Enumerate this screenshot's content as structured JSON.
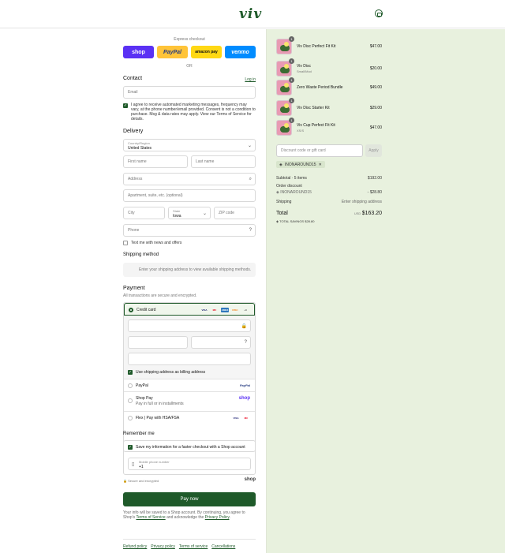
{
  "header": {
    "logo": "viv",
    "cart_icon": "bag-icon"
  },
  "express": {
    "label": "Express checkout",
    "wallets": [
      "shop",
      "PayPal",
      "amazon pay",
      "venmo"
    ],
    "or": "OR"
  },
  "contact": {
    "title": "Contact",
    "login": "Log in",
    "email_placeholder": "Email",
    "consent": "I agree to receive automated marketing messages, frequency may vary, at the phone number/email provided. Consent is not a condition to purchase. Msg & data rates may apply. View our Terms of Service for details."
  },
  "delivery": {
    "title": "Delivery",
    "country_label": "Country/Region",
    "country_value": "United States",
    "first_name": "First name",
    "last_name": "Last name",
    "address": "Address",
    "apartment": "Apartment, suite, etc. (optional)",
    "city": "City",
    "state_label": "State",
    "state_value": "Iowa",
    "zip": "ZIP code",
    "phone": "Phone",
    "text_me": "Text me with news and offers"
  },
  "shipping": {
    "title": "Shipping method",
    "note": "Enter your shipping address to view available shipping methods."
  },
  "payment": {
    "title": "Payment",
    "subtitle": "All transactions are secure and encrypted.",
    "credit_card": "Credit card",
    "card_brands": [
      "VISA",
      "MC",
      "AMEX",
      "DISC",
      "+3"
    ],
    "billing_same": "Use shipping address as billing address",
    "paypal": "PayPal",
    "paypal_logo": "PayPal",
    "shoppay": "Shop Pay",
    "shoppay_sub": "Pay in full or in installments",
    "shoppay_logo": "shop",
    "flex": "Flex | Pay with HSA/FSA",
    "flex_brands": [
      "VISA",
      "MC"
    ]
  },
  "remember": {
    "title": "Remember me",
    "save": "Save my information for a faster checkout with a Shop account",
    "mobile_label": "Mobile phone number",
    "mobile_value": "+1",
    "secure": "Secure and encrypted",
    "shop_logo": "shop"
  },
  "pay_now": "Pay now",
  "legal": {
    "prefix": "Your info will be saved to a Shop account. By continuing, you agree to Shop's",
    "tos": "Terms of Service",
    "mid": "and acknowledge the",
    "privacy": "Privacy Policy",
    "suffix": "."
  },
  "footer": [
    "Refund policy",
    "Privacy policy",
    "Terms of service",
    "Cancellations"
  ],
  "summary": {
    "items": [
      {
        "qty": "1",
        "name": "Viv Disc Perfect Fit Kit",
        "sub": "",
        "price": "$47.00"
      },
      {
        "qty": "1",
        "name": "Viv Disc",
        "sub": "Small/Mod",
        "price": "$20.00"
      },
      {
        "qty": "1",
        "name": "Zero Waste Period Bundle",
        "sub": "",
        "price": "$49.00"
      },
      {
        "qty": "1",
        "name": "Viv Disc Starter Kit",
        "sub": "",
        "price": "$29.00"
      },
      {
        "qty": "1",
        "name": "Viv Cup Perfect Fit Kit",
        "sub": "XS/S",
        "price": "$47.00"
      }
    ],
    "discount_placeholder": "Discount code or gift card",
    "apply": "Apply",
    "code": "INONAROUND15",
    "subtotal_label": "Subtotal · 5 items",
    "subtotal": "$192.00",
    "order_discount": "Order discount",
    "discount_code": "INONAROUND15",
    "discount_value": "- $28.80",
    "shipping_label": "Shipping",
    "shipping_value": "Enter shipping address",
    "total_label": "Total",
    "currency": "USD",
    "total": "$163.20",
    "savings_label": "TOTAL SAVINGS",
    "savings": "$28.80"
  },
  "colors": {
    "brand": "#1f5a2a",
    "summary_bg": "#e8f1de",
    "shop": "#5a31f4"
  }
}
